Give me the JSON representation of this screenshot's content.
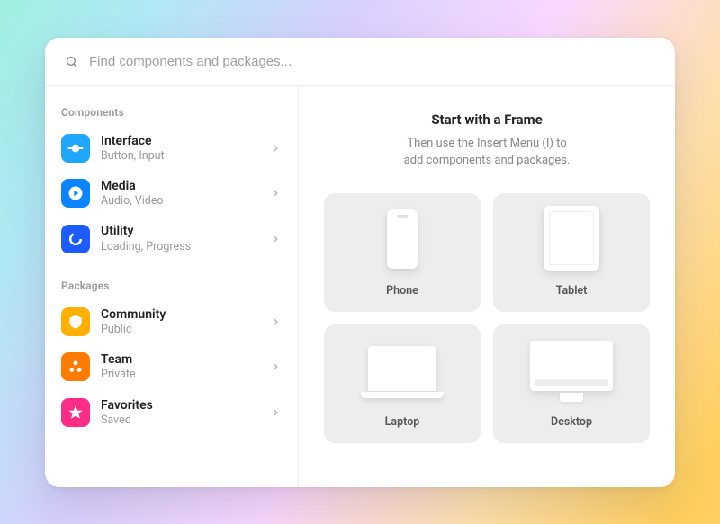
{
  "search": {
    "placeholder": "Find components and packages..."
  },
  "sidebar": {
    "section_components": "Components",
    "section_packages": "Packages",
    "components": [
      {
        "title": "Interface",
        "subtitle": "Button, Input",
        "icon": "interface",
        "color": "#1EA7FD"
      },
      {
        "title": "Media",
        "subtitle": "Audio, Video",
        "icon": "media",
        "color": "#0A84FF"
      },
      {
        "title": "Utility",
        "subtitle": "Loading, Progress",
        "icon": "utility",
        "color": "#1B5BFF"
      }
    ],
    "packages": [
      {
        "title": "Community",
        "subtitle": "Public",
        "icon": "community",
        "color": "#FFB000"
      },
      {
        "title": "Team",
        "subtitle": "Private",
        "icon": "team",
        "color": "#FF7A00"
      },
      {
        "title": "Favorites",
        "subtitle": "Saved",
        "icon": "favorites",
        "color": "#FF2D87"
      }
    ]
  },
  "main": {
    "title": "Start with a Frame",
    "subtitle_line1": "Then use the Insert Menu (I) to",
    "subtitle_line2": "add components and packages.",
    "frames": [
      {
        "label": "Phone",
        "kind": "phone"
      },
      {
        "label": "Tablet",
        "kind": "tablet"
      },
      {
        "label": "Laptop",
        "kind": "laptop"
      },
      {
        "label": "Desktop",
        "kind": "desktop"
      }
    ]
  }
}
